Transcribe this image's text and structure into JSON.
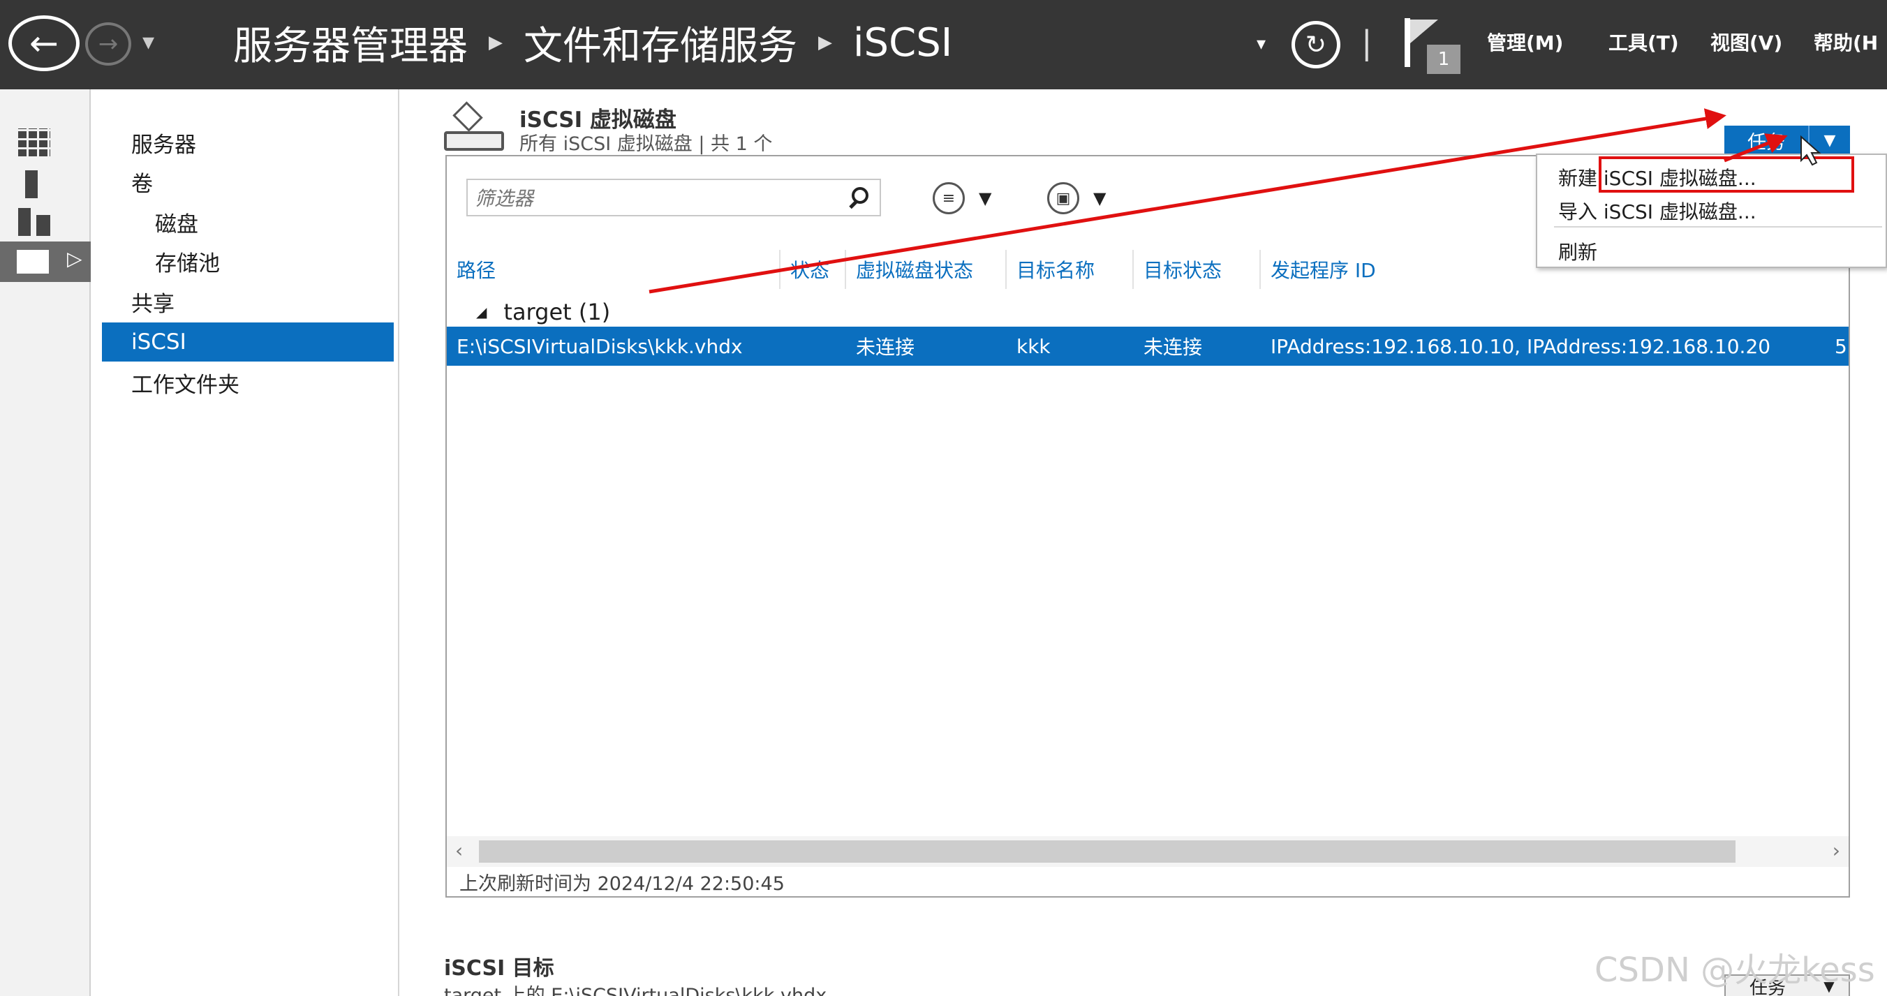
{
  "titlebar": {
    "breadcrumb": [
      "服务器管理器",
      "文件和存储服务",
      "iSCSI"
    ],
    "notification_count": "1",
    "menus": [
      "管理(M)",
      "工具(T)",
      "视图(V)",
      "帮助(H"
    ]
  },
  "nav": {
    "items": [
      {
        "label": "服务器",
        "level": 0
      },
      {
        "label": "卷",
        "level": 0
      },
      {
        "label": "磁盘",
        "level": 1
      },
      {
        "label": "存储池",
        "level": 1
      },
      {
        "label": "共享",
        "level": 0
      },
      {
        "label": "iSCSI",
        "level": 0,
        "active": true
      },
      {
        "label": "工作文件夹",
        "level": 0
      }
    ]
  },
  "section": {
    "title": "iSCSI 虚拟磁盘",
    "subtitle": "所有 iSCSI 虚拟磁盘 | 共 1 个",
    "tasks_label": "任务"
  },
  "tasks_menu": {
    "items": [
      "新建 iSCSI 虚拟磁盘...",
      "导入 iSCSI 虚拟磁盘...",
      "刷新"
    ]
  },
  "grid": {
    "filter_placeholder": "筛选器",
    "columns": [
      "路径",
      "状态",
      "虚拟磁盘状态",
      "目标名称",
      "目标状态",
      "发起程序 ID"
    ],
    "group_label": "target (1)",
    "rows": [
      {
        "path": "E:\\iSCSIVirtualDisks\\kkk.vhdx",
        "status": "",
        "disk_status": "未连接",
        "target_name": "kkk",
        "target_status": "未连接",
        "initiator_id": "IPAddress:192.168.10.10, IPAddress:192.168.10.20",
        "extra": "5"
      }
    ],
    "last_refresh": "上次刷新时间为 2024/12/4 22:50:45"
  },
  "targets": {
    "title": "iSCSI 目标",
    "subtitle": "target 上的 E:\\iSCSIVirtualDisks\\kkk.vhdx",
    "tasks_label": "任务"
  },
  "watermark": "CSDN @火龙kess",
  "colors": {
    "titlebar": "#363636",
    "accent": "#0b6fbf",
    "annotation": "#e01010"
  }
}
